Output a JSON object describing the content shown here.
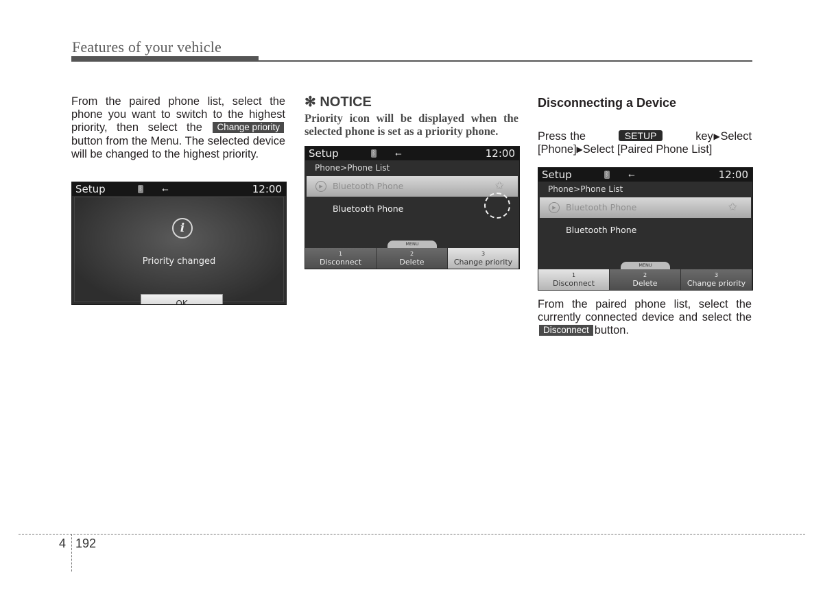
{
  "header": {
    "title": "Features of your vehicle"
  },
  "column1": {
    "paragraph_before": "From the paired phone list, select the phone you want to switch to the highest priority, then select the",
    "inline_button": "Change priority",
    "paragraph_after": "button from the Menu. The selected device will be changed to the highest priority.",
    "screen": {
      "title": "Setup",
      "time": "12:00",
      "icons": [
        "bluetooth-icon",
        "usb-icon"
      ],
      "message": "Priority changed",
      "info_glyph": "i",
      "ok_label": "OK"
    }
  },
  "column2": {
    "notice_title": "✻ NOTICE",
    "notice_body": "Priority icon will be displayed when the selected phone is set as a priority phone.",
    "screen": {
      "title": "Setup",
      "time": "12:00",
      "breadcrumb": "Phone>Phone List",
      "rows": [
        {
          "label": "Bluetooth Phone",
          "selected": true,
          "priority_star": true
        },
        {
          "label": "Bluetooth Phone",
          "selected": false
        }
      ],
      "menu_tab": "MENU",
      "menu": [
        {
          "num": "1",
          "label": "Disconnect",
          "active": false
        },
        {
          "num": "2",
          "label": "Delete",
          "active": false
        },
        {
          "num": "3",
          "label": "Change priority",
          "active": true
        }
      ]
    }
  },
  "column3": {
    "section_title": "Disconnecting a Device",
    "instr_press": "Press the",
    "key_label": "SETUP",
    "instr_key": "key",
    "instr_select1": "Select [Phone]",
    "instr_select2": "Select [Paired Phone List]",
    "arrow": "▶",
    "screen": {
      "title": "Setup",
      "time": "12:00",
      "breadcrumb": "Phone>Phone List",
      "rows": [
        {
          "label": "Bluetooth Phone",
          "selected": true,
          "priority_star": true
        },
        {
          "label": "Bluetooth Phone",
          "selected": false
        }
      ],
      "menu_tab": "MENU",
      "menu": [
        {
          "num": "1",
          "label": "Disconnect",
          "active": true
        },
        {
          "num": "2",
          "label": "Delete",
          "active": false
        },
        {
          "num": "3",
          "label": "Change priority",
          "active": false
        }
      ]
    },
    "paragraph_before": "From the paired phone list, select the currently connected device and select the",
    "inline_button": "Disconnect",
    "paragraph_after": "button."
  },
  "footer": {
    "chapter": "4",
    "page": "192"
  }
}
